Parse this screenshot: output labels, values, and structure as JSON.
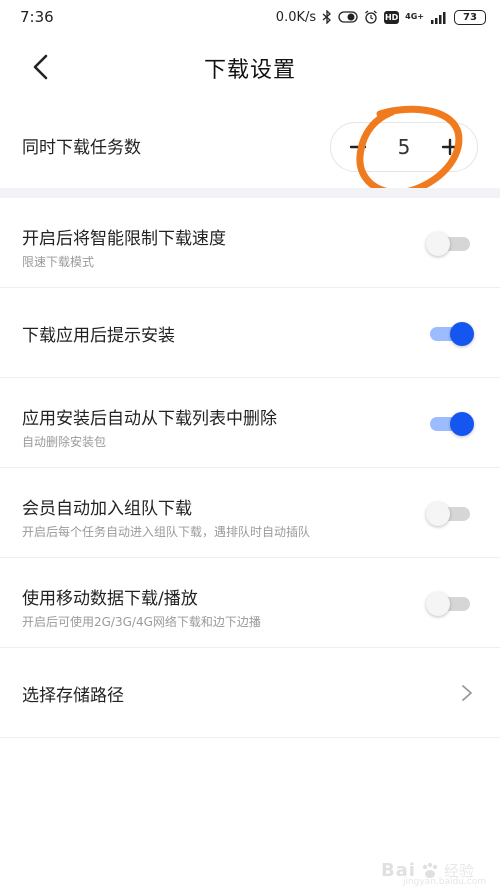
{
  "status_bar": {
    "time": "7:36",
    "speed": "0.0K/s",
    "hd_label": "HD",
    "network_top": "4G+",
    "battery": "73"
  },
  "header": {
    "title": "下载设置",
    "back_icon": "chevron-left-icon"
  },
  "concurrent_downloads": {
    "label": "同时下载任务数",
    "value": "5",
    "decrement_icon": "minus-icon",
    "increment_icon": "plus-icon"
  },
  "settings": [
    {
      "id": "speed-limit",
      "label": "开启后将智能限制下载速度",
      "sub": "限速下载模式",
      "enabled": false
    },
    {
      "id": "install-prompt",
      "label": "下载应用后提示安装",
      "sub": "",
      "enabled": true
    },
    {
      "id": "auto-delete",
      "label": "应用安装后自动从下载列表中删除",
      "sub": "自动删除安装包",
      "enabled": true
    },
    {
      "id": "team-download",
      "label": "会员自动加入组队下载",
      "sub": "开启后每个任务自动进入组队下载，遇排队时自动插队",
      "enabled": false
    },
    {
      "id": "mobile-data",
      "label": "使用移动数据下载/播放",
      "sub": "开启后可使用2G/3G/4G网络下载和边下边播",
      "enabled": false
    }
  ],
  "storage_path": {
    "label": "选择存储路径",
    "icon": "chevron-right-icon"
  },
  "colors": {
    "accent": "#1556f0",
    "annotation": "#f07a1e",
    "divider": "#f2f3f7"
  },
  "watermark": {
    "brand": "Bai",
    "text": "经验",
    "url": "jingyan.baidu.com"
  }
}
